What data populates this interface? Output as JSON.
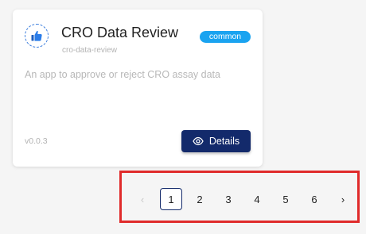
{
  "card": {
    "title": "CRO Data Review",
    "slug": "cro-data-review",
    "badge": "common",
    "description": "An app to approve or reject CRO assay data",
    "version": "v0.0.3",
    "details_label": "Details",
    "icon": "thumbs-up-icon"
  },
  "pagination": {
    "prev": "‹",
    "next": "›",
    "pages": [
      "1",
      "2",
      "3",
      "4",
      "5",
      "6"
    ],
    "current": "1",
    "prev_disabled": true
  },
  "colors": {
    "accent": "#132a6b",
    "badge": "#1aa3f0",
    "highlight": "#e02b2b"
  }
}
